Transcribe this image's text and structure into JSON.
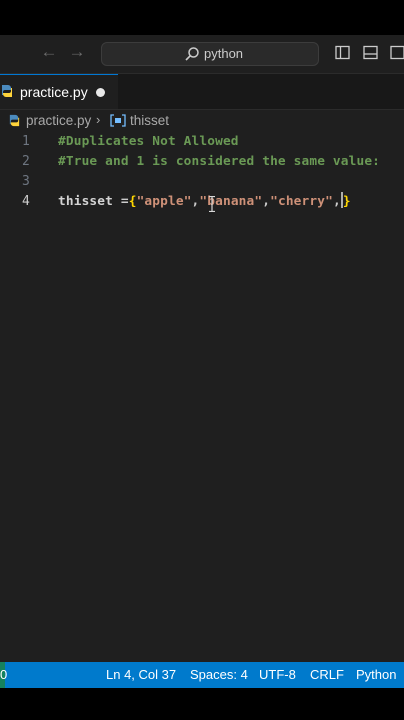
{
  "window": {
    "search_text": "python"
  },
  "tab": {
    "filename": "practice.py",
    "unsaved": true
  },
  "breadcrumb": {
    "file": "practice.py",
    "symbol": "thisset"
  },
  "editor": {
    "lines": [
      {
        "number": "1",
        "text": "#Duplicates Not Allowed"
      },
      {
        "number": "2",
        "text": "#True and 1 is considered the same value:"
      },
      {
        "number": "3",
        "text": ""
      },
      {
        "number": "4",
        "var": "thisset",
        "op": " =",
        "open": "{",
        "s1": "\"apple\"",
        "s2": "\"banana\"",
        "s3": "\"cherry\"",
        "comma": ",",
        "close": "}"
      }
    ]
  },
  "statusbar": {
    "position": "Ln 4, Col 37",
    "spaces": "Spaces: 4",
    "encoding": "UTF-8",
    "eol": "CRLF",
    "language": "Python",
    "remote_text": "0"
  },
  "colors": {
    "accent": "#007acc",
    "comment": "#6a9955",
    "string": "#ce9178",
    "bracket": "#ffd700"
  }
}
